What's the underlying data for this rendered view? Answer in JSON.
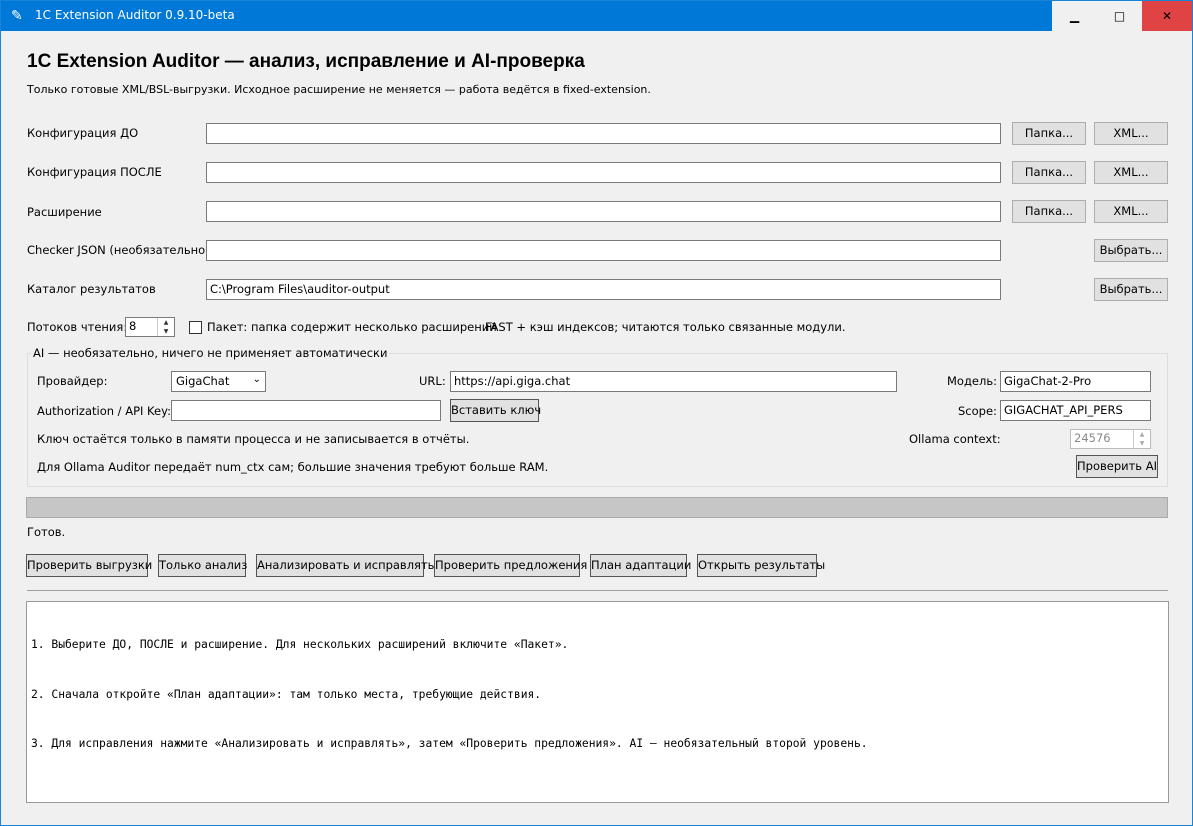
{
  "window": {
    "title": "1C Extension Auditor 0.9.10-beta",
    "minimize_glyph": "▁",
    "maximize_glyph": "□",
    "close_glyph": "✕",
    "app_icon_glyph": "✎"
  },
  "header": {
    "title": "1C Extension Auditor — анализ, исправление и AI-проверка",
    "subtitle": "Только готовые XML/BSL-выгрузки. Исходное расширение не меняется — работа ведётся в fixed-extension."
  },
  "inputs": {
    "config_before": {
      "label": "Конфигурация ДО",
      "value": "",
      "folder_button": "Папка...",
      "xml_button": "XML..."
    },
    "config_after": {
      "label": "Конфигурация ПОСЛЕ",
      "value": "",
      "folder_button": "Папка...",
      "xml_button": "XML..."
    },
    "extension": {
      "label": "Расширение",
      "value": "",
      "folder_button": "Папка...",
      "xml_button": "XML..."
    },
    "checker_json": {
      "label": "Checker JSON (необязательно)",
      "value": "",
      "choose_button": "Выбрать..."
    },
    "output_dir": {
      "label": "Каталог результатов",
      "value": "C:\\Program Files\\auditor-output",
      "choose_button": "Выбрать..."
    }
  },
  "options": {
    "threads_label": "Потоков чтения:",
    "threads_value": "8",
    "batch_label": "Пакет: папка содержит несколько расширений",
    "batch_checked": false,
    "fast_note": "FAST + кэш индексов; читаются только связанные модули."
  },
  "ai": {
    "group_label": "AI — необязательно, ничего не применяет автоматически",
    "provider_label": "Провайдер:",
    "provider_value": "GigaChat",
    "url_label": "URL:",
    "url_value": "https://api.giga.chat",
    "model_label": "Модель:",
    "model_value": "GigaChat-2-Pro",
    "key_label": "Authorization / API Key:",
    "key_value": "",
    "paste_key_button": "Вставить ключ",
    "scope_label": "Scope:",
    "scope_value": "GIGACHAT_API_PERS",
    "key_note": "Ключ остаётся только в памяти процесса и не записывается в отчёты.",
    "ollama_context_label": "Ollama context:",
    "ollama_context_value": "24576",
    "ollama_note": "Для Ollama Auditor передаёт num_ctx сам; большие значения требуют больше RAM.",
    "check_ai_button": "Проверить AI"
  },
  "progress": {
    "value": 0
  },
  "status": "Готов.",
  "actions": {
    "check_exports": "Проверить выгрузки",
    "analyze_only": "Только анализ",
    "analyze_fix": "Анализировать и исправлять",
    "check_proposals": "Проверить предложения",
    "adaptation_plan": "План адаптации",
    "open_results": "Открыть результаты"
  },
  "log": {
    "lines": [
      "1. Выберите ДО, ПОСЛЕ и расширение. Для нескольких расширений включите «Пакет».",
      "2. Сначала откройте «План адаптации»: там только места, требующие действия.",
      "3. Для исправления нажмите «Анализировать и исправлять», затем «Проверить предложения». AI — необязательный второй уровень."
    ]
  }
}
